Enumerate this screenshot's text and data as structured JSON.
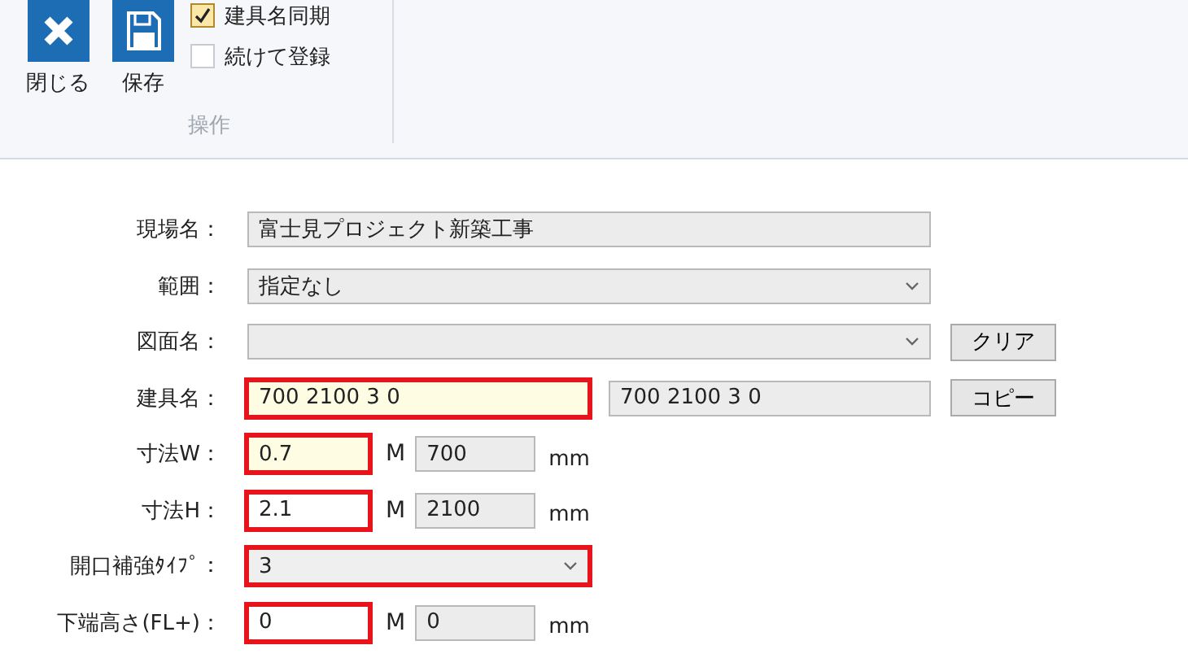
{
  "ribbon": {
    "buttons": [
      {
        "kind": "close",
        "label": "閉じる"
      },
      {
        "kind": "save",
        "label": "保存"
      }
    ],
    "checkboxes": [
      {
        "label": "建具名同期",
        "checked": true
      },
      {
        "label": "続けて登録",
        "checked": false
      }
    ],
    "group_label": "操作"
  },
  "form": {
    "rows": [
      {
        "label": "現場名：",
        "kind": "readonly",
        "value": "富士見プロジェクト新築工事"
      },
      {
        "label": "範囲：",
        "kind": "dropdown",
        "value": "指定なし",
        "outlined": false
      },
      {
        "label": "図面名：",
        "kind": "dropdown",
        "value": "",
        "outlined": false,
        "button": "クリア"
      },
      {
        "label": "建具名：",
        "kind": "text",
        "value": "700 2100 3 0",
        "outlined": true,
        "focused": true,
        "mirror": "700 2100 3 0",
        "button": "コピー"
      },
      {
        "label": "寸法W：",
        "kind": "size",
        "value": "0.7",
        "outlined": true,
        "focused": true,
        "unit": "M",
        "mirror": "700",
        "mirror_unit": "mm"
      },
      {
        "label": "寸法H：",
        "kind": "size",
        "value": "2.1",
        "outlined": true,
        "focused": false,
        "unit": "M",
        "mirror": "2100",
        "mirror_unit": "mm"
      },
      {
        "label": "開口補強ﾀｲﾌﾟ：",
        "kind": "dropdown",
        "value": "3",
        "outlined": true
      },
      {
        "label": "下端高さ(FL+)：",
        "kind": "size",
        "value": "0",
        "outlined": true,
        "focused": false,
        "unit": "M",
        "mirror": "0",
        "mirror_unit": "mm"
      }
    ]
  }
}
